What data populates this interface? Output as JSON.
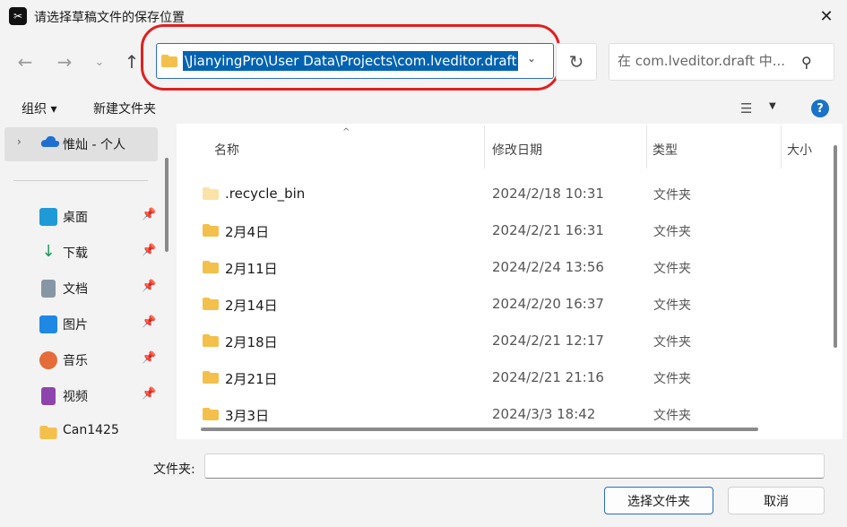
{
  "window": {
    "title": "请选择草稿文件的保存位置",
    "app_icon_glyph": "✂",
    "close_glyph": "✕"
  },
  "address": {
    "path": "\\JianyingPro\\User Data\\Projects\\com.lveditor.draft",
    "dropdown_glyph": "⌄"
  },
  "nav_glyphs": {
    "back": "←",
    "forward": "→",
    "recent": "⌄",
    "up": "↑",
    "refresh": "↻"
  },
  "search": {
    "placeholder": "在 com.lveditor.draft 中...",
    "icon_glyph": "⚲"
  },
  "toolbar": {
    "organize_label": "组织 ▾",
    "new_folder_label": "新建文件夹",
    "view_glyph": "☰",
    "view_dropdown_glyph": "▼",
    "help_glyph": "?"
  },
  "sidebar": {
    "onedrive": {
      "label": "惟灿 - 个人",
      "chevron": "›"
    },
    "pin_glyph": "📌",
    "items": [
      {
        "label": "桌面",
        "icon": "desktop-icon",
        "color": "#1e9bd7"
      },
      {
        "label": "下载",
        "icon": "download-icon",
        "color": "#1a9b5a"
      },
      {
        "label": "文档",
        "icon": "documents-icon",
        "color": "#6c7a89"
      },
      {
        "label": "图片",
        "icon": "pictures-icon",
        "color": "#1e88e5"
      },
      {
        "label": "音乐",
        "icon": "music-icon",
        "color": "#e66b3a"
      },
      {
        "label": "视频",
        "icon": "videos-icon",
        "color": "#8e44ad"
      },
      {
        "label": "Can1425",
        "icon": "folder-icon",
        "color": "#f4c04c"
      }
    ]
  },
  "file_list": {
    "columns": [
      "名称",
      "修改日期",
      "类型",
      "大小"
    ],
    "sort_glyph": "^",
    "rows": [
      {
        "name": ".recycle_bin",
        "date": "2024/2/18 10:31",
        "type": "文件夹",
        "faded": true
      },
      {
        "name": "2月4日",
        "date": "2024/2/21 16:31",
        "type": "文件夹",
        "faded": false
      },
      {
        "name": "2月11日",
        "date": "2024/2/24 13:56",
        "type": "文件夹",
        "faded": false
      },
      {
        "name": "2月14日",
        "date": "2024/2/20 16:37",
        "type": "文件夹",
        "faded": false
      },
      {
        "name": "2月18日",
        "date": "2024/2/21 12:17",
        "type": "文件夹",
        "faded": false
      },
      {
        "name": "2月21日",
        "date": "2024/2/21 21:16",
        "type": "文件夹",
        "faded": false
      },
      {
        "name": "3月3日",
        "date": "2024/3/3 18:42",
        "type": "文件夹",
        "faded": false
      }
    ]
  },
  "footer": {
    "folder_label": "文件夹:",
    "folder_value": "",
    "select_button": "选择文件夹",
    "cancel_button": "取消"
  },
  "colors": {
    "accent": "#0063b1",
    "annotation": "#e02020",
    "folder": "#f4c04c"
  }
}
